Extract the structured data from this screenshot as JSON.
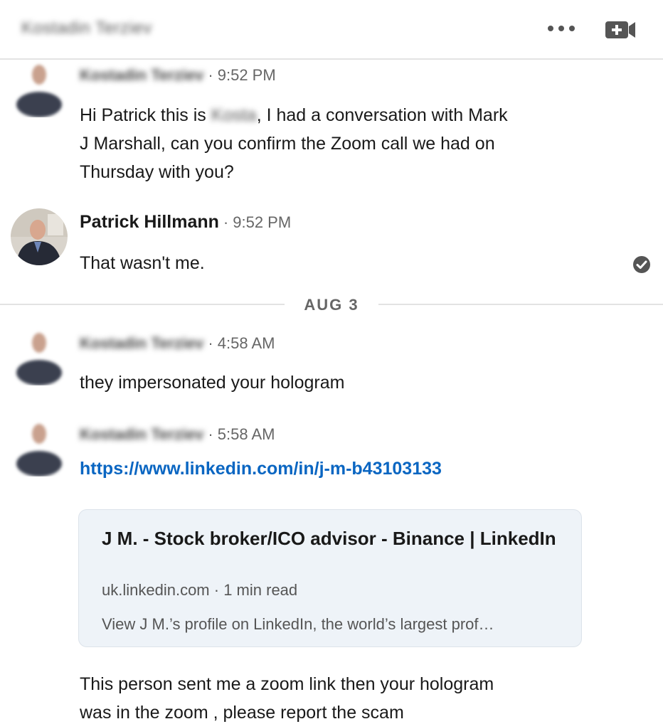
{
  "header": {
    "name": "Kostadin Terziev"
  },
  "messages": [
    {
      "sender": "Kostadin Terziev",
      "time": "9:52 PM",
      "text_before": "Hi Patrick this is ",
      "redacted": "Kosta",
      "text_after": ", I had a conversation with Mark",
      "line2": "J Marshall, can you confirm the Zoom call we had on",
      "line3": "Thursday with you?"
    },
    {
      "sender": "Patrick Hillmann",
      "time": "9:52 PM",
      "text": "That wasn't me."
    },
    {
      "sender": "Kostadin Terziev",
      "time": "4:58 AM",
      "text": "they impersonated your hologram"
    },
    {
      "sender": "Kostadin Terziev",
      "time": "5:58 AM",
      "link": "https://www.linkedin.com/in/j-m-b43103133",
      "followup_line1": "This person sent me a zoom link then your hologram",
      "followup_line2": "was in the zoom , please report the scam"
    }
  ],
  "divider": {
    "label": "AUG 3"
  },
  "link_preview": {
    "title": "J M. - Stock broker/ICO advisor - Binance | LinkedIn",
    "domain": "uk.linkedin.com",
    "read_time": "1 min read",
    "description": "View J M.’s profile on LinkedIn, the world’s largest prof…"
  },
  "icons": {
    "more": "more-horizontal-icon",
    "video": "video-call-icon",
    "read_receipt": "check-circle-icon"
  },
  "colors": {
    "link": "#0a66c2",
    "preview_bg": "#eef3f8"
  }
}
